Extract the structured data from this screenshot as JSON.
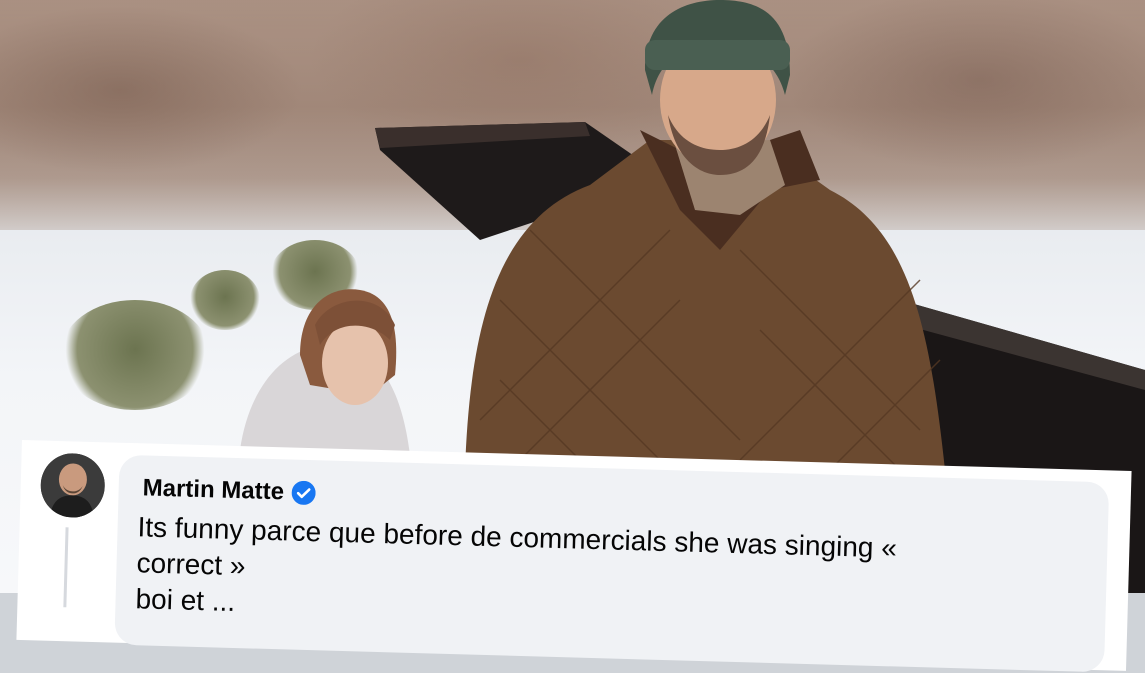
{
  "comment": {
    "author_name": "Martin Matte",
    "verified_icon": "verified-badge-icon",
    "text_lines": [
      "Its funny parce que before de commercials she was singing «",
      "correct »",
      "boi et ..."
    ]
  },
  "colors": {
    "verified_blue": "#1877f2",
    "bubble_bg": "#f0f2f5",
    "text": "#050505"
  }
}
